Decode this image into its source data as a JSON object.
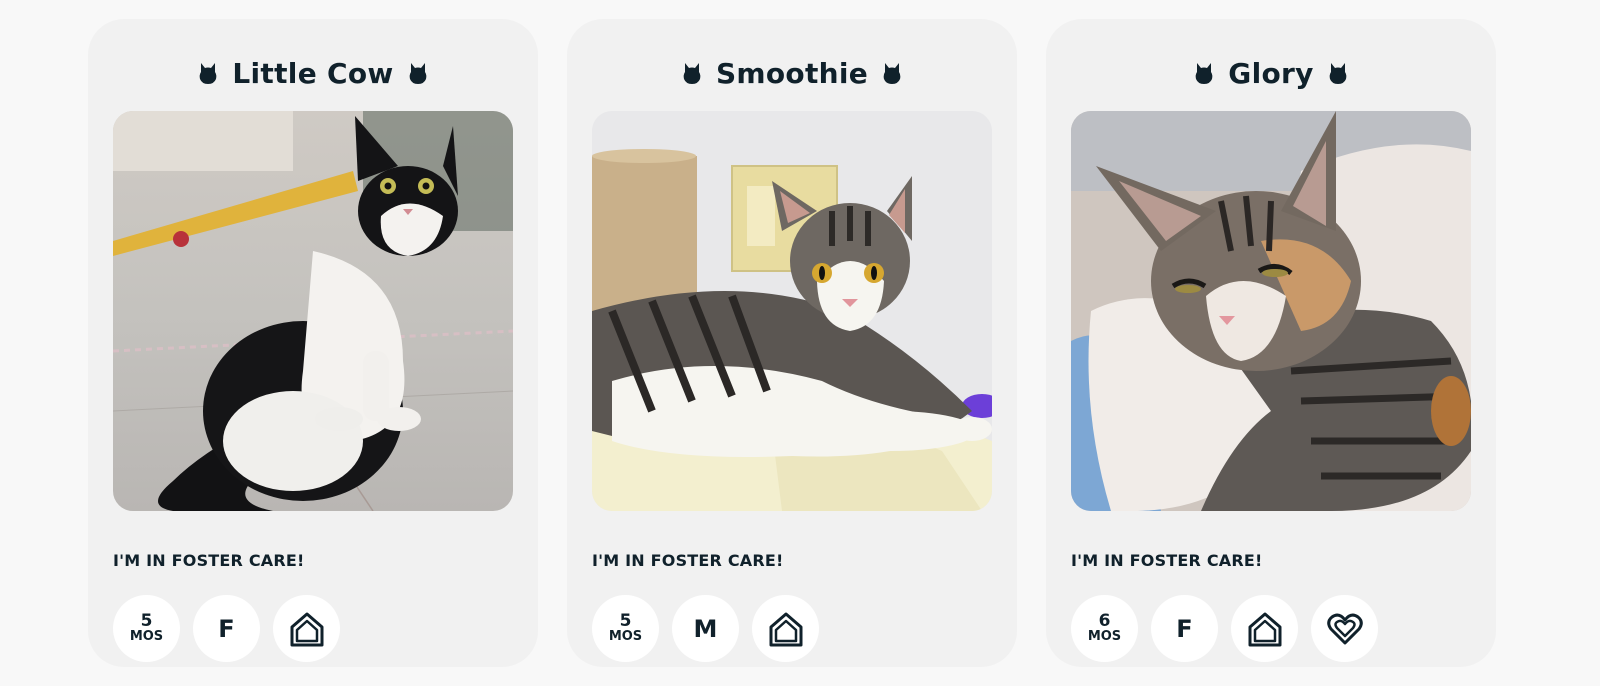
{
  "cards": [
    {
      "name": "Little Cow",
      "status": "I'M IN FOSTER CARE!",
      "age_number": "5",
      "age_unit": "MOS",
      "sex": "F",
      "badges": [
        "age-badge",
        "sex-badge",
        "house-icon"
      ],
      "photo": "black-and-white-kitten-sitting-photo"
    },
    {
      "name": "Smoothie",
      "status": "I'M IN FOSTER CARE!",
      "age_number": "5",
      "age_unit": "MOS",
      "sex": "M",
      "badges": [
        "age-badge",
        "sex-badge",
        "house-icon"
      ],
      "photo": "tabby-and-white-kitten-lying-photo"
    },
    {
      "name": "Glory",
      "status": "I'M IN FOSTER CARE!",
      "age_number": "6",
      "age_unit": "MOS",
      "sex": "F",
      "badges": [
        "age-badge",
        "sex-badge",
        "house-icon",
        "heart-icon"
      ],
      "photo": "calico-tabby-kitten-resting-photo"
    }
  ],
  "icons": {
    "title_decoration": "cat-silhouette-icon",
    "foster": "house-icon",
    "bonded": "heart-icon"
  },
  "colors": {
    "page_background": "#f8f8f8",
    "card_background": "#f1f1f1",
    "badge_background": "#ffffff",
    "text": "#10212b"
  }
}
